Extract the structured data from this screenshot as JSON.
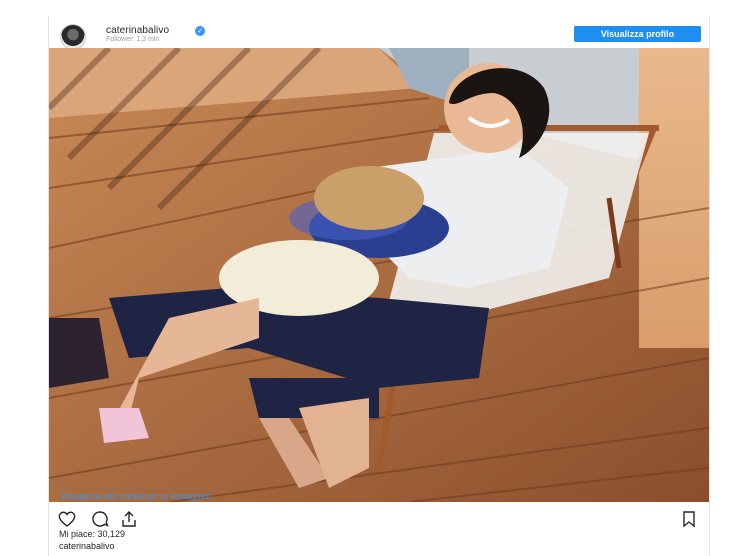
{
  "header": {
    "username": "caterinabalivo",
    "followers": "Follower: 1,3 mln",
    "view_profile_label": "Visualizza profilo"
  },
  "photo": {
    "icon": "photo-mother-and-child-on-deck-chair"
  },
  "footer": {
    "more_link": "Visualizza altri contenuti su Instagram",
    "likes": "Mi piace: 30,129",
    "caption_user": "caterinabalivo"
  },
  "colors": {
    "accent": "#1e8ef0",
    "link": "#3897f0",
    "verified": "#3897f0"
  },
  "icons": [
    "heart-icon",
    "comment-icon",
    "share-icon",
    "bookmark-icon",
    "verified-icon"
  ]
}
